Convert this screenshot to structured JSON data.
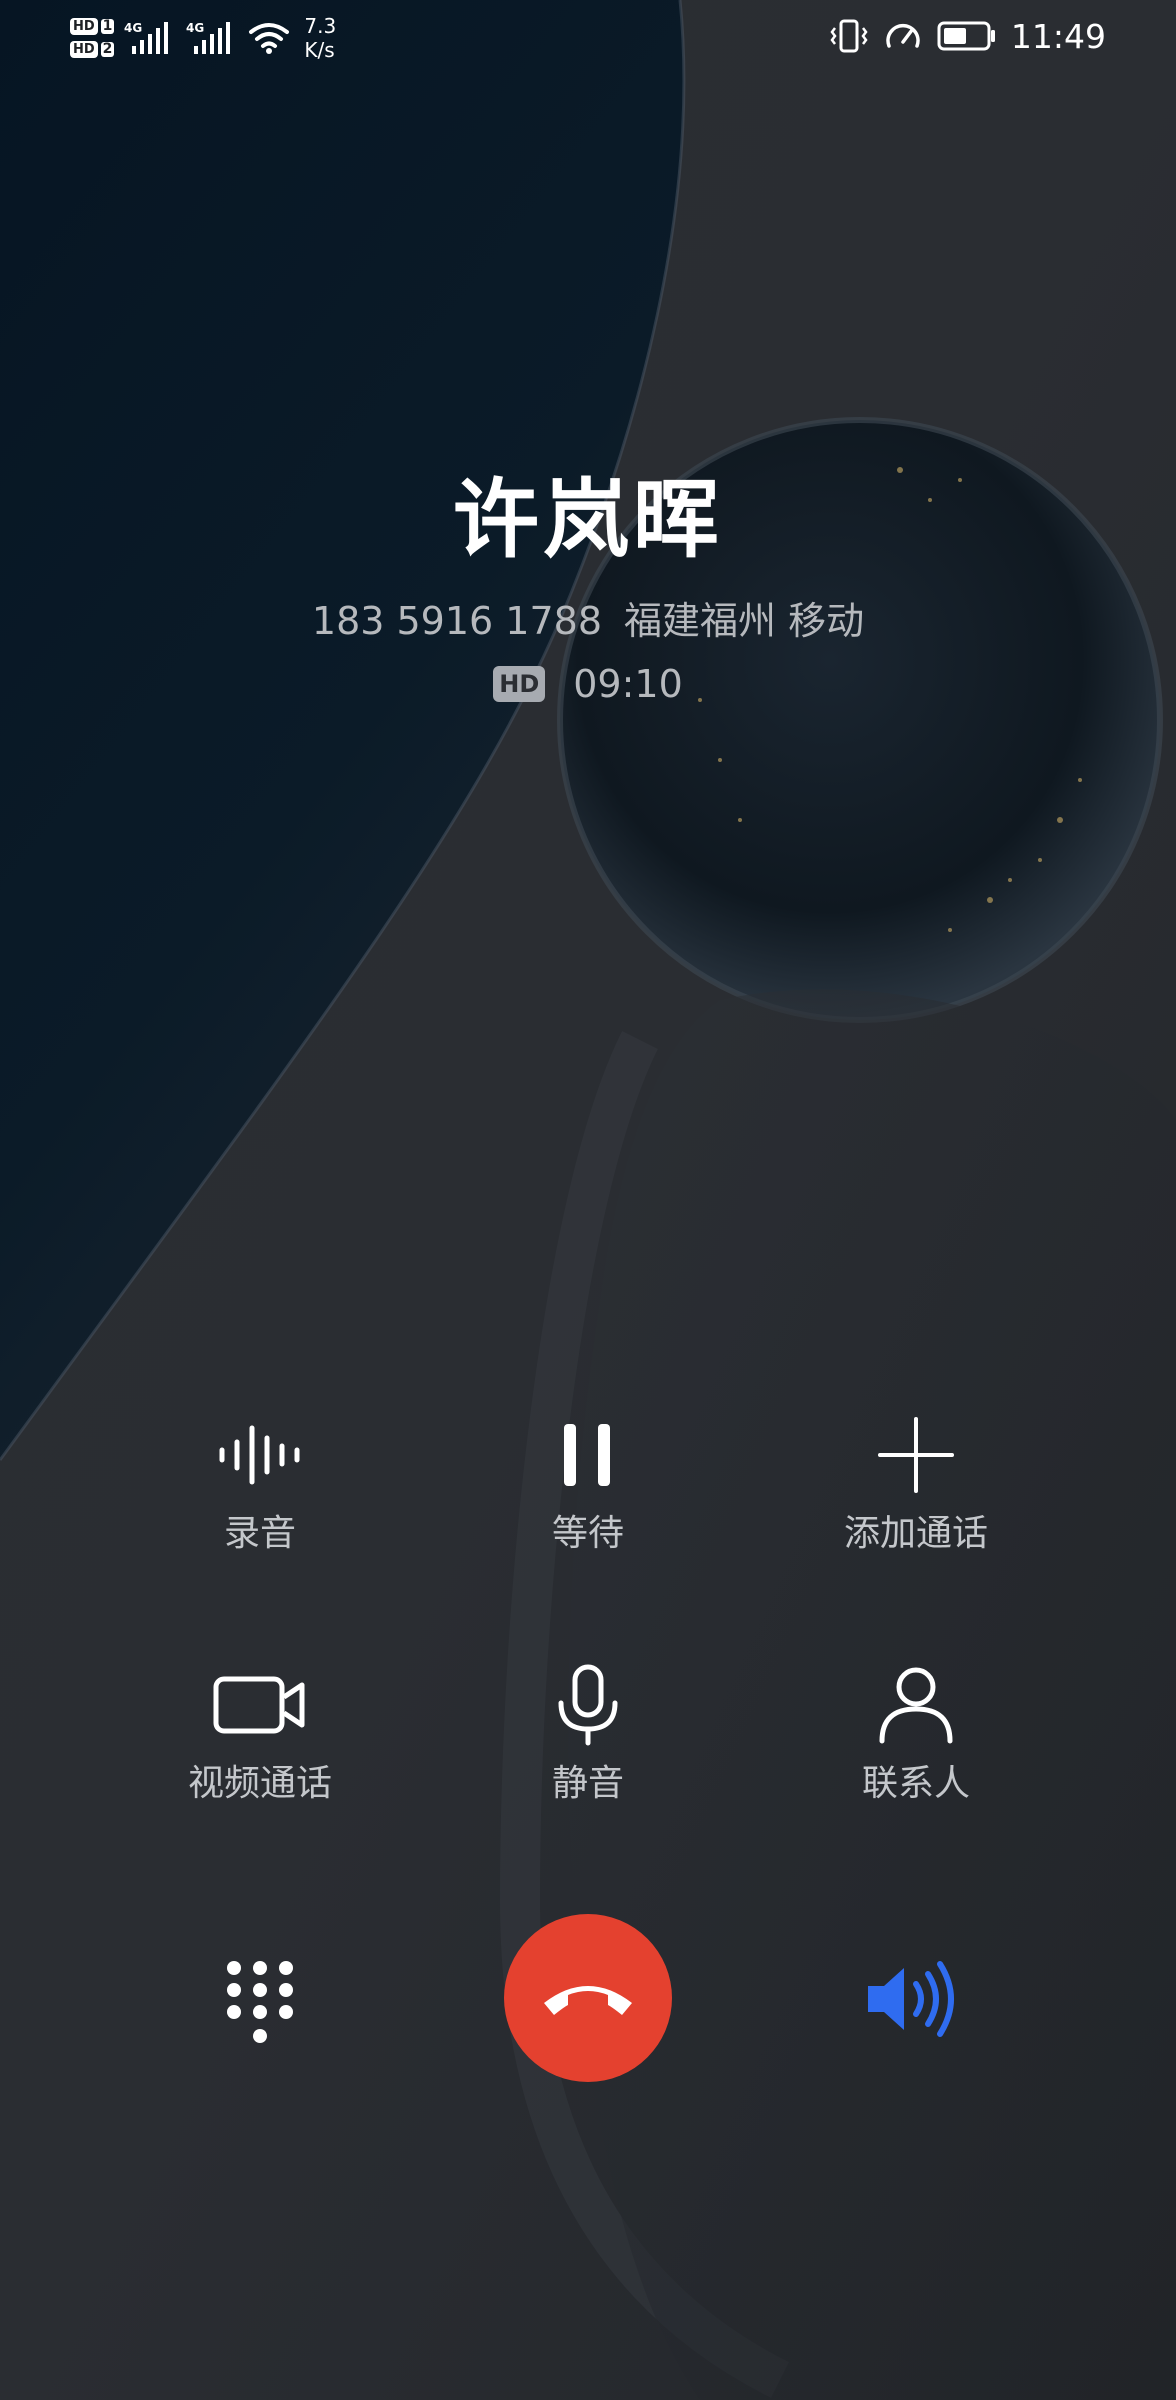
{
  "status_bar": {
    "sim1_label": "HD",
    "sim1_num": "1",
    "sim2_label": "HD",
    "sim2_num": "2",
    "network_type_1": "4G",
    "network_type_2": "4G",
    "net_speed_value": "7.3",
    "net_speed_unit": "K/s",
    "time": "11:49",
    "icons": [
      "vibrate-icon",
      "speed-icon",
      "battery-icon"
    ]
  },
  "call": {
    "contact_name": "许岚晖",
    "phone_number": "183 5916 1788",
    "location_carrier": "福建福州 移动",
    "hd_badge": "HD",
    "duration": "09:10"
  },
  "actions": [
    {
      "label": "录音",
      "icon": "record-waveform-icon"
    },
    {
      "label": "等待",
      "icon": "pause-icon"
    },
    {
      "label": "添加通话",
      "icon": "add-call-icon"
    },
    {
      "label": "视频通话",
      "icon": "video-camera-icon"
    },
    {
      "label": "静音",
      "icon": "microphone-icon"
    },
    {
      "label": "联系人",
      "icon": "contact-person-icon"
    }
  ],
  "bottom_controls": {
    "dialpad_icon": "dialpad-icon",
    "end_call_icon": "end-call-icon",
    "speaker_icon": "speaker-icon",
    "speaker_active": true
  },
  "colors": {
    "end_call": "#e4412f",
    "speaker_active": "#2f6cf0",
    "label_text": "#c4c7cb",
    "info_text": "#b6b9bd"
  }
}
